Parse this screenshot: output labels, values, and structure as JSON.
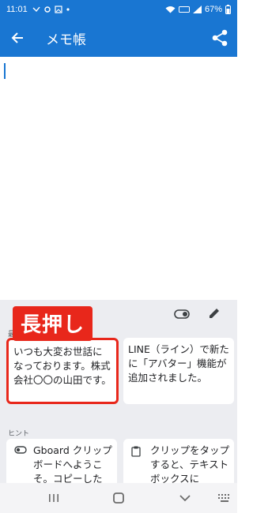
{
  "status_bar": {
    "time": "11:01",
    "battery": "67%"
  },
  "app_bar": {
    "title": "メモ帳",
    "back_icon": "arrow-back-icon",
    "share_icon": "share-icon"
  },
  "editor": {
    "text": ""
  },
  "keyboard": {
    "recent_label": "最近",
    "hint_label": "ヒント",
    "clips": [
      {
        "text": "いつも大変お世話になっております。株式会社〇〇の山田です。",
        "highlighted": true
      },
      {
        "text": "LINE（ライン）で新たに「アバター」機能が追加されました。",
        "highlighted": false
      }
    ],
    "hints": [
      {
        "text": "Gboard クリップボードへようこそ。コピーした",
        "icon": "toggle-icon"
      },
      {
        "text": "クリップをタップすると、テキスト ボックスに",
        "icon": "clipboard-icon"
      }
    ]
  },
  "callout": {
    "text": "長押し",
    "color": "#e8271b"
  },
  "accent_color": "#1976d2"
}
